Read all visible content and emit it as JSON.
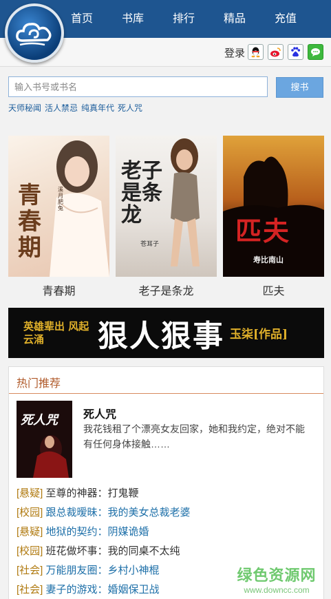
{
  "nav": {
    "items": [
      "首页",
      "书库",
      "排行",
      "精品",
      "充值"
    ]
  },
  "login": {
    "label": "登录",
    "social_icons": [
      "qq-icon",
      "weibo-icon",
      "baidu-icon",
      "wechat-icon"
    ]
  },
  "search": {
    "placeholder": "输入书号或书名",
    "button_label": "搜书"
  },
  "hot_keywords": [
    "天师秘闻",
    "活人禁忌",
    "纯真年代",
    "死人咒"
  ],
  "covers": [
    {
      "title": "青春期",
      "art_title": "青春期",
      "art_author": "溪月肥兔"
    },
    {
      "title": "老子是条龙",
      "art_title": "老子是条龙",
      "art_author": "苍耳子"
    },
    {
      "title": "匹夫",
      "art_title": "匹夫",
      "art_author": "寿比南山"
    }
  ],
  "banner": {
    "left": "英雄辈出 风起云涌",
    "main": "狠人狠事",
    "right": "玉柒[作品]"
  },
  "hot_section": {
    "title": "热门推荐",
    "featured": {
      "title": "死人咒",
      "description": "我花钱租了个漂亮女友回家，她和我约定，绝对不能有任何身体接触……"
    },
    "list": [
      {
        "category": "[悬疑]",
        "title": "至尊的神器：打鬼鞭",
        "blue": false
      },
      {
        "category": "[校园]",
        "title": "跟总裁暧昧：我的美女总裁老婆",
        "blue": true
      },
      {
        "category": "[悬疑]",
        "title": "地狱的契约：阴媒诡婚",
        "blue": true
      },
      {
        "category": "[校园]",
        "title": "班花做坏事：我的同桌不太纯",
        "blue": false
      },
      {
        "category": "[社会]",
        "title": "万能朋友圈：乡村小神棍",
        "blue": true
      },
      {
        "category": "[社会]",
        "title": "妻子的游戏：婚姻保卫战",
        "blue": true
      }
    ]
  },
  "watermark": {
    "name": "绿色资源网",
    "url": "www.downcc.com"
  },
  "colors": {
    "nav_bg": "#1e5590",
    "link": "#1d5e9c",
    "category": "#b07a10",
    "accent": "#b05a2a"
  }
}
